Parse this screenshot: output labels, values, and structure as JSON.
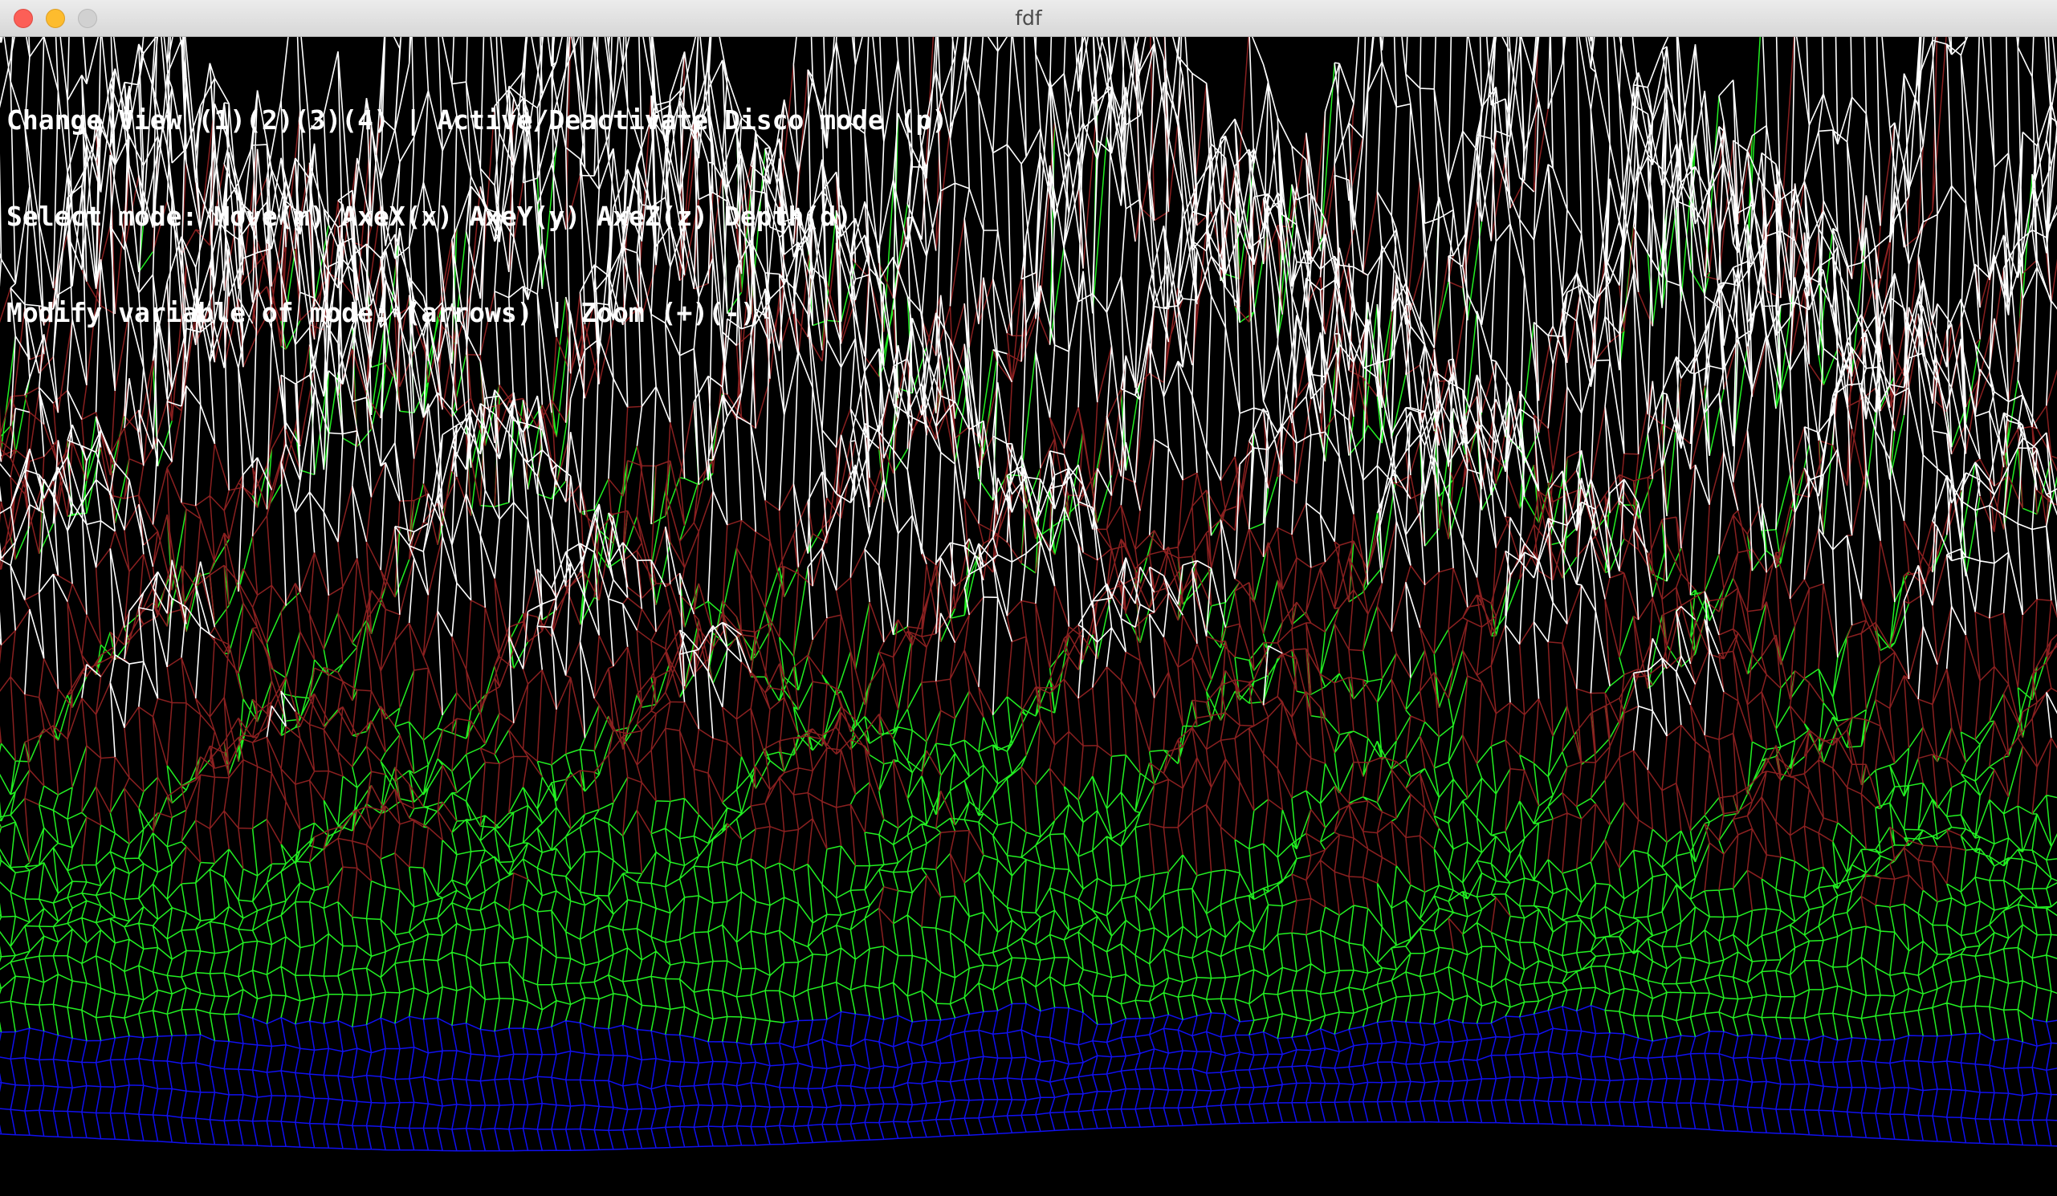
{
  "window": {
    "title": "fdf"
  },
  "help": {
    "lines": [
      "Change View (1)(2)(3)(4) | Active/Deactivate Disco mode (p)",
      "Select mode: Move(m) AxeX(x) AxeY(y) AxeZ(z) Depth(d)",
      "Modify variable of mode: (arrows) | Zoom (+)(-)"
    ]
  },
  "render": {
    "background_color": "#000000",
    "elevation_colors": {
      "water": "#1010f0",
      "grass": "#22f022",
      "earth": "#8a2020",
      "snow": "#ffffff"
    }
  }
}
